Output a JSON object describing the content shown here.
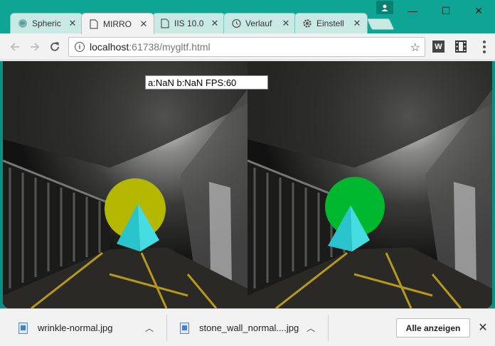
{
  "tabs": [
    {
      "label": "Spheric",
      "icon": "globe-icon",
      "active": false
    },
    {
      "label": "MIRRO",
      "icon": "page-icon",
      "active": true
    },
    {
      "label": "IIS 10.0",
      "icon": "page-icon",
      "active": false
    },
    {
      "label": "Verlauf",
      "icon": "history-icon",
      "active": false
    },
    {
      "label": "Einstell",
      "icon": "gear-icon",
      "active": false
    }
  ],
  "tab_close_glyph": "✕",
  "window_controls": {
    "minimize": "—",
    "maximize": "☐",
    "close": "✕"
  },
  "address_bar": {
    "host": "localhost",
    "path": ":61738/mygltf.html"
  },
  "extensions": {
    "w_label": "W"
  },
  "hud": {
    "text": "a:NaN b:NaN FPS:60"
  },
  "downloads": [
    {
      "filename": "wrinkle-normal.jpg"
    },
    {
      "filename": "stone_wall_normal....jpg"
    }
  ],
  "show_all_label": "Alle anzeigen",
  "colors": {
    "titlebar": "#0fa595",
    "left_sphere": "#b5b800",
    "right_sphere": "#00b830",
    "pyramid": "#2dd2d8"
  }
}
